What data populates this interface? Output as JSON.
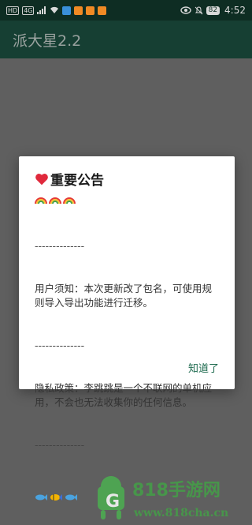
{
  "status_bar": {
    "left_tags": [
      "HD",
      "4G"
    ],
    "battery": "82",
    "time": "4:52"
  },
  "app": {
    "title": "派大星2.2"
  },
  "dialog": {
    "title": "重要公告",
    "separator": "--------------",
    "notice_label": "用户须知：本次更新改了包名，可使用规则导入导出功能进行迁移。",
    "privacy_label": "隐私政策：李跳跳是一个不联网的单机应用，不会也无法收集你的任何信息。",
    "ok_button": "知道了"
  },
  "watermark": {
    "text": "818手游网",
    "url": "www.818cha.cn"
  },
  "colors": {
    "status_bar": "#0e2d23",
    "app_bar": "#163f33",
    "overlay": "#5f5f5f",
    "accent": "#1e6b4f"
  },
  "icons": [
    "wifi-icon",
    "signal-icon",
    "eye-icon",
    "mute-icon",
    "heart-icon",
    "rainbow-icon",
    "fish-icon",
    "tropical-fish-icon"
  ]
}
